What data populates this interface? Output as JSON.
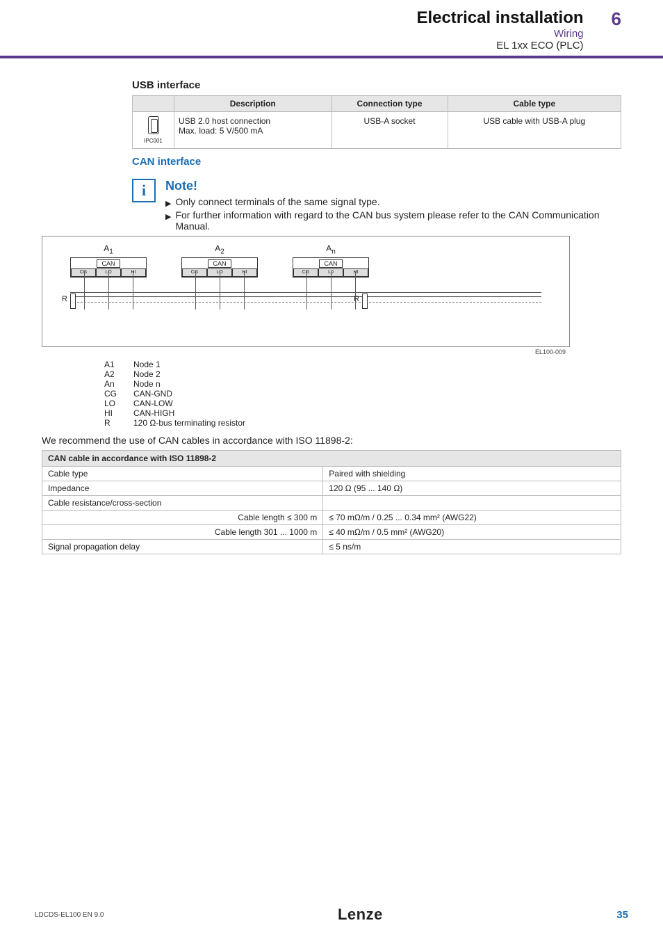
{
  "header": {
    "title": "Electrical installation",
    "sub1": "Wiring",
    "sub2": "EL 1xx ECO (PLC)",
    "chapter": "6"
  },
  "usb": {
    "heading": "USB interface",
    "cols": {
      "desc": "Description",
      "conn": "Connection type",
      "cable": "Cable type"
    },
    "row": {
      "desc1": "USB 2.0 host connection",
      "desc2": "Max. load: 5 V/500 mA",
      "conn": "USB-A socket",
      "cable": "USB cable with USB-A plug",
      "ipc": "IPC001"
    }
  },
  "can": {
    "heading": "CAN interface",
    "note_label": "Note!",
    "bullets": [
      "Only connect terminals of the same signal type.",
      "For further information with regard to the CAN bus system please refer to the CAN Communication Manual."
    ],
    "diagram": {
      "a1": "A",
      "a1sub": "1",
      "a2": "A",
      "a2sub": "2",
      "an": "A",
      "ansub": "n",
      "can": "CAN",
      "pin_cg": "CG",
      "pin_lo": "LO",
      "pin_hi": "HI",
      "pin_l0": "L0",
      "r": "R",
      "ref": "EL100-009"
    },
    "legend": [
      [
        "A1",
        "Node 1"
      ],
      [
        "A2",
        "Node 2"
      ],
      [
        "An",
        "Node n"
      ],
      [
        "CG",
        "CAN-GND"
      ],
      [
        "LO",
        "CAN-LOW"
      ],
      [
        "HI",
        "CAN-HIGH"
      ],
      [
        "R",
        "120 Ω-bus terminating resistor"
      ]
    ],
    "para": "We recommend the use of CAN cables in accordance with ISO 11898-2:",
    "spec": {
      "title": "CAN cable in accordance with ISO 11898-2",
      "rows": [
        [
          "Cable type",
          "Paired with shielding"
        ],
        [
          "Impedance",
          "120 Ω (95 ... 140 Ω)"
        ],
        [
          "Cable resistance/cross-section",
          ""
        ],
        [
          "Cable length ≤ 300 m",
          "≤ 70 mΩ/m / 0.25 ... 0.34 mm² (AWG22)"
        ],
        [
          "Cable length 301 ... 1000 m",
          "≤ 40 mΩ/m / 0.5 mm² (AWG20)"
        ],
        [
          "Signal propagation delay",
          "≤ 5 ns/m"
        ]
      ]
    }
  },
  "footer": {
    "docid": "LDCDS-EL100  EN  9.0",
    "logo": "Lenze",
    "page": "35"
  }
}
